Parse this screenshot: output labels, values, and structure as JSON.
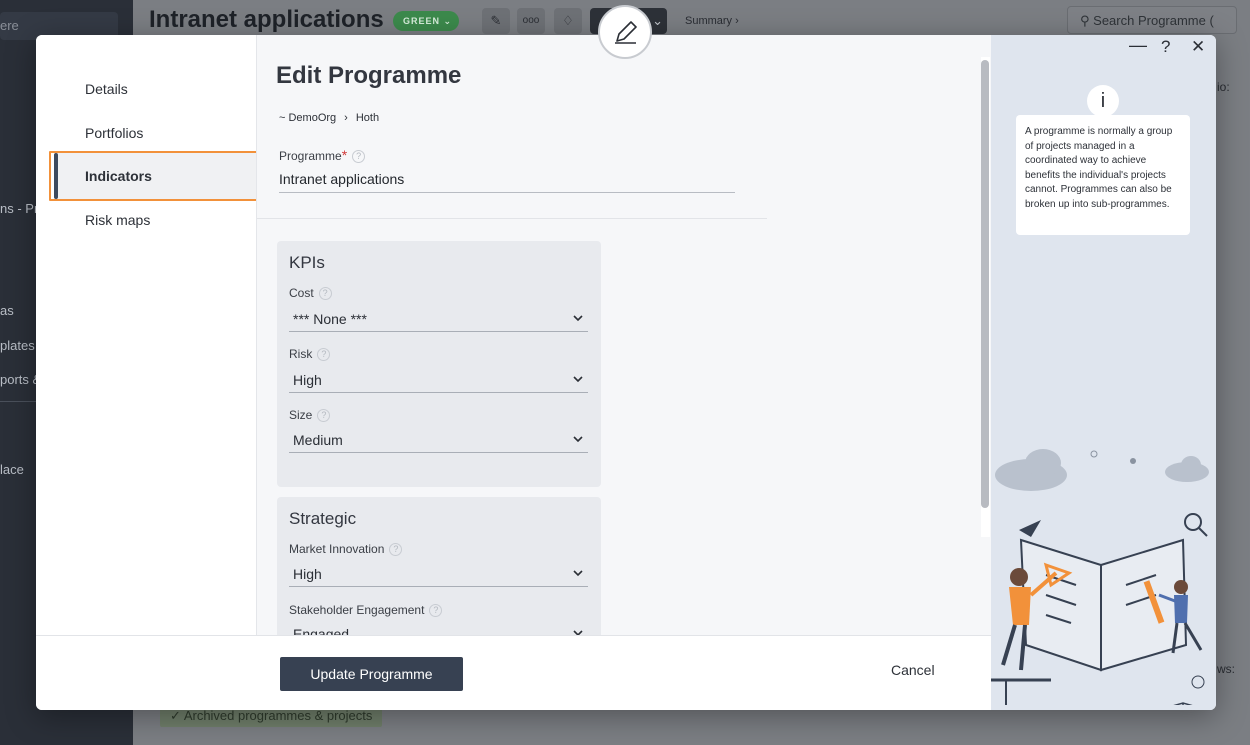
{
  "background": {
    "sidebar": {
      "search_fragment": "ere",
      "items": [
        {
          "label": "ns - Pro"
        },
        {
          "label": "as"
        },
        {
          "label": "plates"
        },
        {
          "label": "ports &"
        },
        {
          "label": "lace"
        }
      ]
    },
    "title": "Intranet applications",
    "status_badge": "GREEN",
    "toolbar_more": "ooo",
    "summary_link": "Summary ›",
    "search_placeholder": "Search Programme (",
    "right_tab_fragment": "io:",
    "rows_fragment": "ws:",
    "archived_label": "Archived programmes & projects"
  },
  "modal": {
    "nav": {
      "items": [
        {
          "label": "Details"
        },
        {
          "label": "Portfolios"
        },
        {
          "label": "Indicators"
        },
        {
          "label": "Risk maps"
        }
      ],
      "active_index": 2
    },
    "form": {
      "title": "Edit Programme",
      "breadcrumb": [
        "~ DemoOrg",
        "Hoth"
      ],
      "programme_label": "Programme",
      "programme_value": "Intranet applications",
      "kpis": {
        "title": "KPIs",
        "fields": [
          {
            "label": "Cost",
            "value": "*** None ***"
          },
          {
            "label": "Risk",
            "value": "High"
          },
          {
            "label": "Size",
            "value": "Medium"
          }
        ]
      },
      "strategic": {
        "title": "Strategic",
        "fields": [
          {
            "label": "Market Innovation",
            "value": "High"
          },
          {
            "label": "Stakeholder Engagement",
            "value": "Engaged"
          }
        ]
      }
    },
    "footer": {
      "update_label": "Update Programme",
      "cancel_label": "Cancel"
    },
    "info_panel": {
      "minimize": "—",
      "help": "?",
      "close": "✕",
      "tip_icon": "i",
      "tip_text": "A programme is normally a group of projects managed in a coordinated way to achieve benefits the individual's projects cannot. Programmes can also be broken up into sub-programmes."
    }
  },
  "colors": {
    "highlight": "#f2913a",
    "primary_button": "#374152",
    "badge_green": "#3c8a4c",
    "info_panel_bg": "#dfe5ee"
  },
  "icons": [
    "pencil-icon",
    "tag-icon",
    "search-icon",
    "chevron-down-icon",
    "help-icon",
    "info-icon",
    "close-icon",
    "minimize-icon"
  ]
}
